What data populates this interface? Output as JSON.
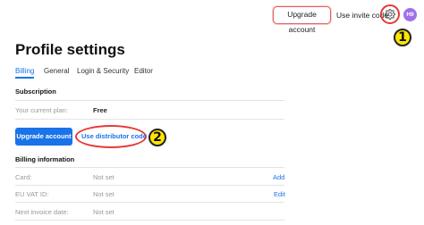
{
  "topbar": {
    "upgrade_label": "Upgrade account",
    "invite_label": "Use invite code",
    "avatar_initials": "H9"
  },
  "callouts": {
    "one": "1",
    "two": "2"
  },
  "page": {
    "title": "Profile settings"
  },
  "tabs": [
    {
      "label": "Billing",
      "active": true
    },
    {
      "label": "General",
      "active": false
    },
    {
      "label": "Login & Security",
      "active": false
    },
    {
      "label": "Editor",
      "active": false
    }
  ],
  "subscription": {
    "heading": "Subscription",
    "plan_label": "Your current plan:",
    "plan_value": "Free",
    "upgrade_button": "Upgrade account",
    "distributor_button": "Use distributor code"
  },
  "billing": {
    "heading": "Billing information",
    "rows": [
      {
        "label": "Card:",
        "value": "Not set",
        "action": "Add"
      },
      {
        "label": "EU VAT ID:",
        "value": "Not set",
        "action": "Edit"
      },
      {
        "label": "Next invoice date:",
        "value": "Not set",
        "action": ""
      }
    ]
  },
  "colors": {
    "accent": "#1a73e8",
    "annotation_red": "#e53935",
    "callout_yellow": "#ffe600",
    "avatar": "#a070e8"
  }
}
